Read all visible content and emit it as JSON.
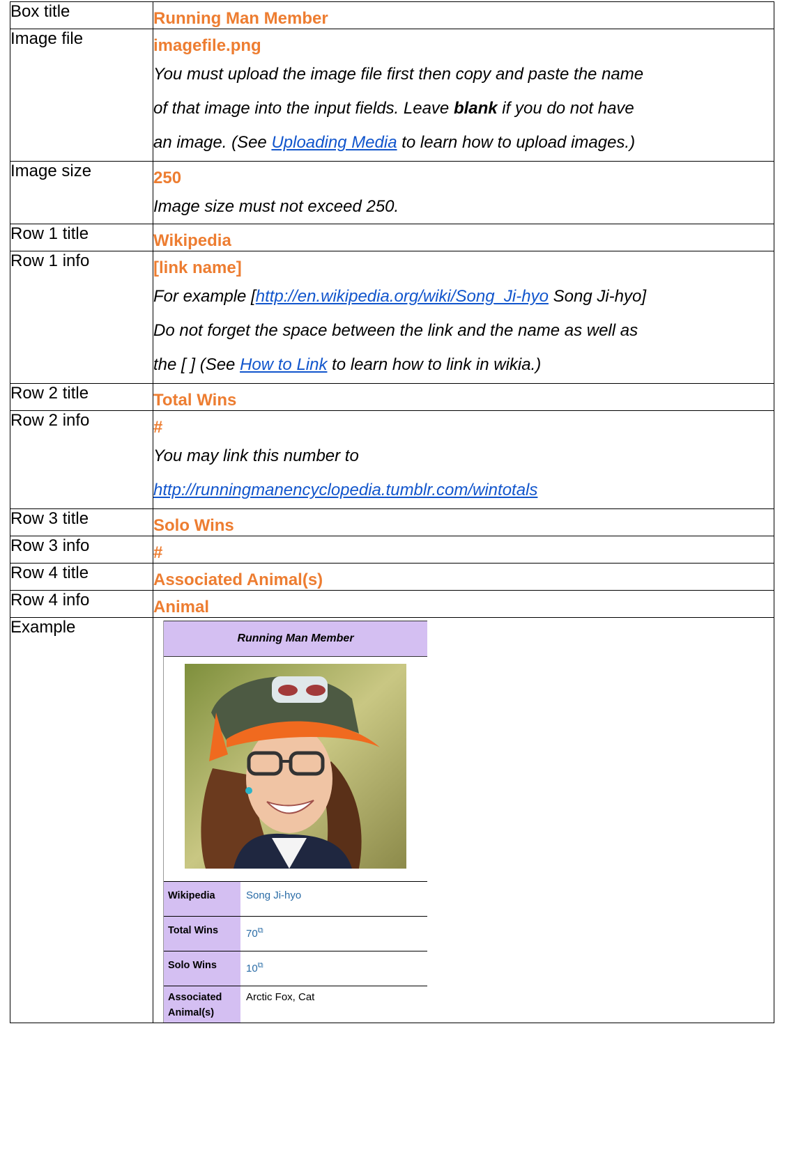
{
  "rows": {
    "box_title": {
      "label": "Box title",
      "value": "Running Man Member"
    },
    "image_file": {
      "label": "Image file",
      "value": "imagefile.png",
      "note_l1": "You must upload the image file first then copy and paste the name",
      "note_l2a": "of that image into the input fields. Leave ",
      "note_l2b": "blank",
      "note_l2c": " if you do not have",
      "note_l3a": "an image. (See ",
      "note_l3_link": "Uploading Media",
      "note_l3b": " to learn how to upload images.)"
    },
    "image_size": {
      "label": "Image size",
      "value": "250",
      "note": "Image size must not exceed 250."
    },
    "row1_title": {
      "label": "Row 1 title",
      "value": "Wikipedia"
    },
    "row1_info": {
      "label": "Row 1 info",
      "value": "[link name]",
      "note_l1a": "For example [",
      "note_l1_link": "http://en.wikipedia.org/wiki/Song_Ji-hyo",
      "note_l1b": " Song Ji-hyo]",
      "note_l2": "Do not forget the space between the link and the name as well as",
      "note_l3a": "the [ ]  (See ",
      "note_l3_link": "How to Link",
      "note_l3b": " to learn how to link in wikia.)"
    },
    "row2_title": {
      "label": "Row 2 title",
      "value": "Total Wins"
    },
    "row2_info": {
      "label": "Row 2 info",
      "value": "#",
      "note_l1": "You may link this number to",
      "note_link": "http://runningmanencyclopedia.tumblr.com/wintotals"
    },
    "row3_title": {
      "label": "Row 3 title",
      "value": "Solo Wins"
    },
    "row3_info": {
      "label": "Row 3 info",
      "value": "#"
    },
    "row4_title": {
      "label": "Row 4 title",
      "value": "Associated Animal(s)"
    },
    "row4_info": {
      "label": "Row 4 info",
      "value": "Animal"
    },
    "example": {
      "label": "Example"
    }
  },
  "infobox": {
    "title": "Running Man Member",
    "photo_icon": "portrait-photo",
    "rows": [
      {
        "key": "Wikipedia",
        "value": "Song Ji-hyo",
        "link": true,
        "ext": false
      },
      {
        "key": "Total Wins",
        "value": "70",
        "link": true,
        "ext": true
      },
      {
        "key": "Solo Wins",
        "value": "10",
        "link": true,
        "ext": true
      },
      {
        "key": "Associated Animal(s)",
        "value": "Arctic Fox, Cat",
        "link": false,
        "ext": false
      }
    ]
  },
  "colors": {
    "value_orange": "#ED7D31",
    "link_blue": "#1155CC",
    "infobox_purple": "#D4BFF2"
  }
}
